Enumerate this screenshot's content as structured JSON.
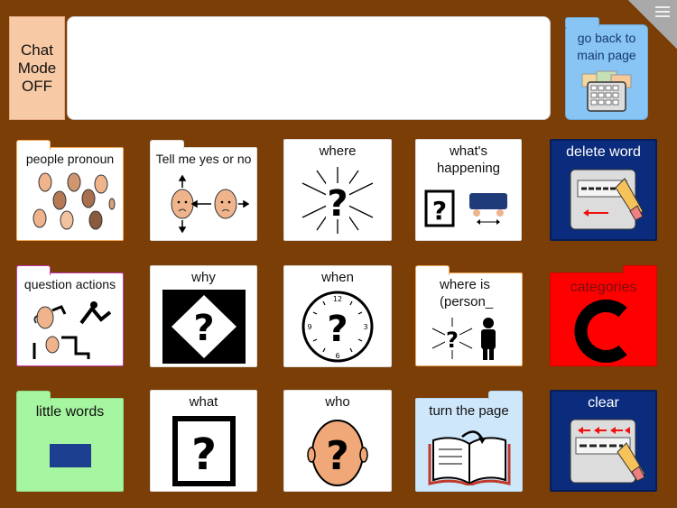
{
  "header": {
    "chat_mode_label": "Chat Mode OFF",
    "message_text": "",
    "main_page_label": "go back to main page"
  },
  "tiles": [
    {
      "label": "people pronoun",
      "icon": "people-faces-icon"
    },
    {
      "label": "Tell me yes or no",
      "icon": "yes-no-faces-icon"
    },
    {
      "label": "where",
      "icon": "where-question-icon"
    },
    {
      "label": "what's happening",
      "icon": "whats-happening-icon"
    },
    {
      "label": "delete word",
      "icon": "eraser-icon"
    },
    {
      "label": "question actions",
      "icon": "question-actions-icon"
    },
    {
      "label": "why",
      "icon": "why-diamond-icon"
    },
    {
      "label": "when",
      "icon": "clock-question-icon"
    },
    {
      "label": "where is (person_",
      "icon": "where-is-person-icon"
    },
    {
      "label": "categories",
      "icon": "letter-c-icon"
    },
    {
      "label": "little words",
      "icon": "blue-rectangle-icon"
    },
    {
      "label": "what",
      "icon": "what-question-icon"
    },
    {
      "label": "who",
      "icon": "who-head-icon"
    },
    {
      "label": "turn the page",
      "icon": "book-icon"
    },
    {
      "label": "clear",
      "icon": "clear-eraser-icon"
    }
  ],
  "colors": {
    "background": "#7a3e06",
    "categories_tile": "#ff0000",
    "little_words_tile": "#a6f5a0",
    "main_page_tile": "#88c4f4",
    "delete_clear_tiles": "#0b2c7c",
    "turn_page_tile": "#cfe7fb"
  }
}
